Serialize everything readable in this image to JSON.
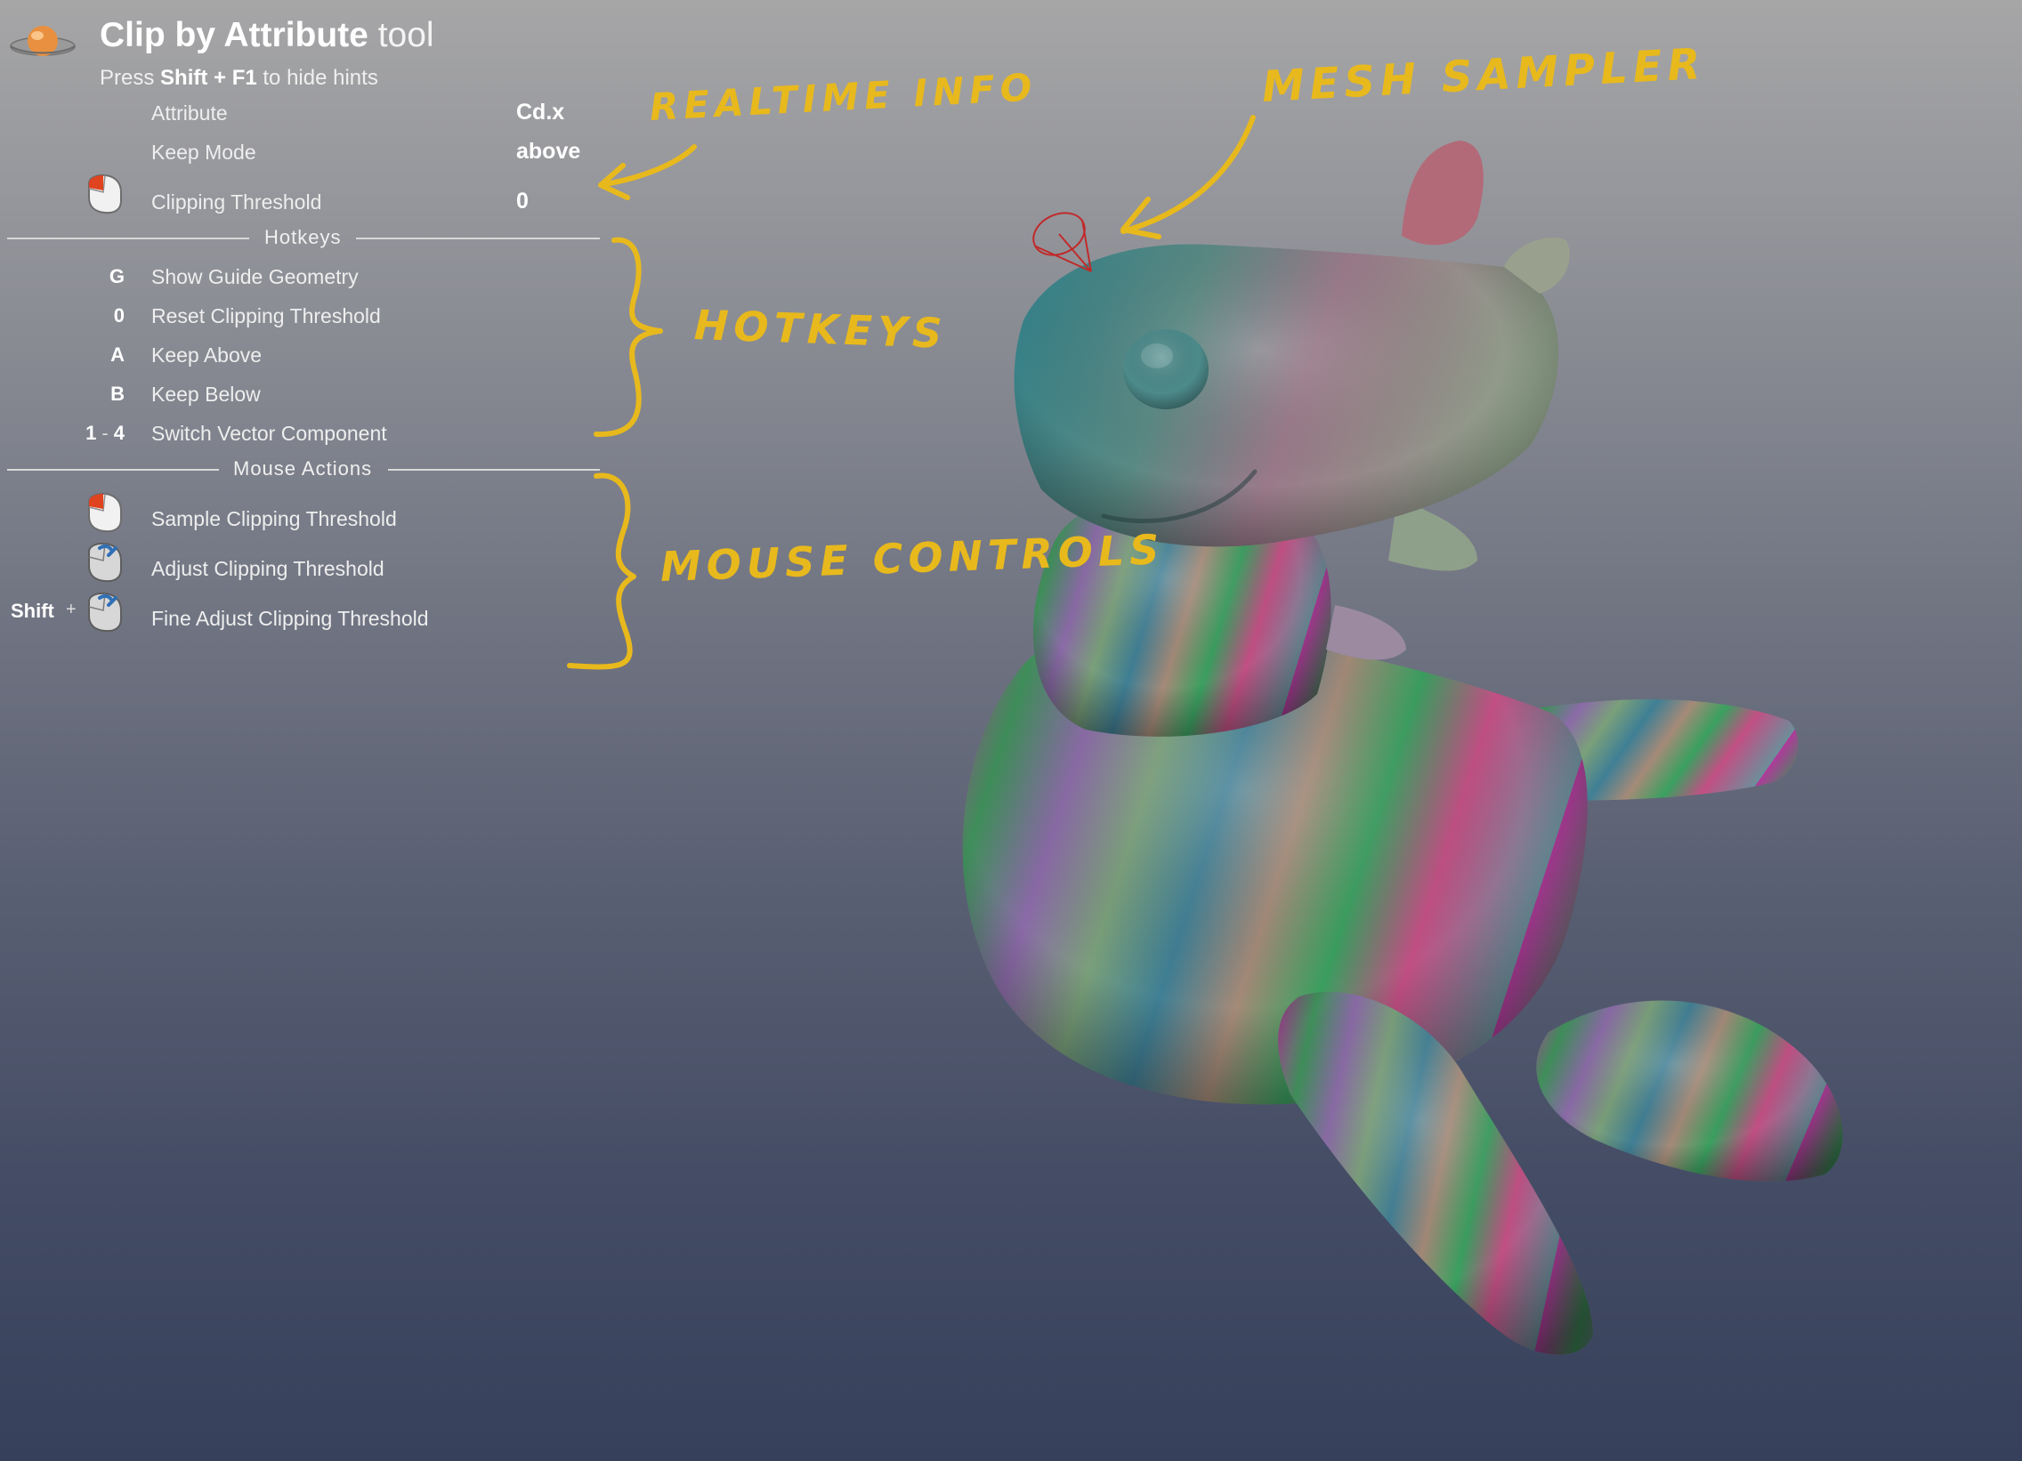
{
  "tool": {
    "title_bold": "Clip by Attribute",
    "title_suffix": "tool",
    "hint_prefix": "Press",
    "hint_keys": "Shift + F1",
    "hint_suffix": "to hide hints"
  },
  "info": [
    {
      "label": "Attribute",
      "value": "Cd.x"
    },
    {
      "label": "Keep Mode",
      "value": "above"
    },
    {
      "label": "Clipping Threshold",
      "value": "0",
      "icon": "mouse-left-click-icon"
    }
  ],
  "hotkeys": {
    "header": "Hotkeys",
    "items": [
      {
        "key": "G",
        "label": "Show Guide Geometry"
      },
      {
        "key": "0",
        "label": "Reset Clipping Threshold"
      },
      {
        "key": "A",
        "label": "Keep Above"
      },
      {
        "key": "B",
        "label": "Keep Below"
      },
      {
        "key_from": "1",
        "key_sep": "-",
        "key_to": "4",
        "label": "Switch Vector Component"
      }
    ]
  },
  "mouse_actions": {
    "header": "Mouse Actions",
    "items": [
      {
        "icon": "mouse-left-click-icon",
        "label": "Sample Clipping Threshold"
      },
      {
        "icon": "mouse-middle-drag-icon",
        "label": "Adjust Clipping Threshold"
      },
      {
        "modifier": "Shift",
        "plus": "+",
        "icon": "mouse-middle-drag-icon",
        "label": "Fine Adjust Clipping Threshold"
      }
    ]
  },
  "annotations": {
    "realtime_info": "REALTIME INFO",
    "hotkeys": "HOTKEYS",
    "mouse_controls": "MOUSE CONTROLS",
    "mesh_sampler": "MESH SAMPLER"
  },
  "colors": {
    "annotation": "#e8b91c",
    "mouse_left": "#e0431f",
    "mouse_middle": "#2f6fb5",
    "sampler": "#c02a2a"
  }
}
